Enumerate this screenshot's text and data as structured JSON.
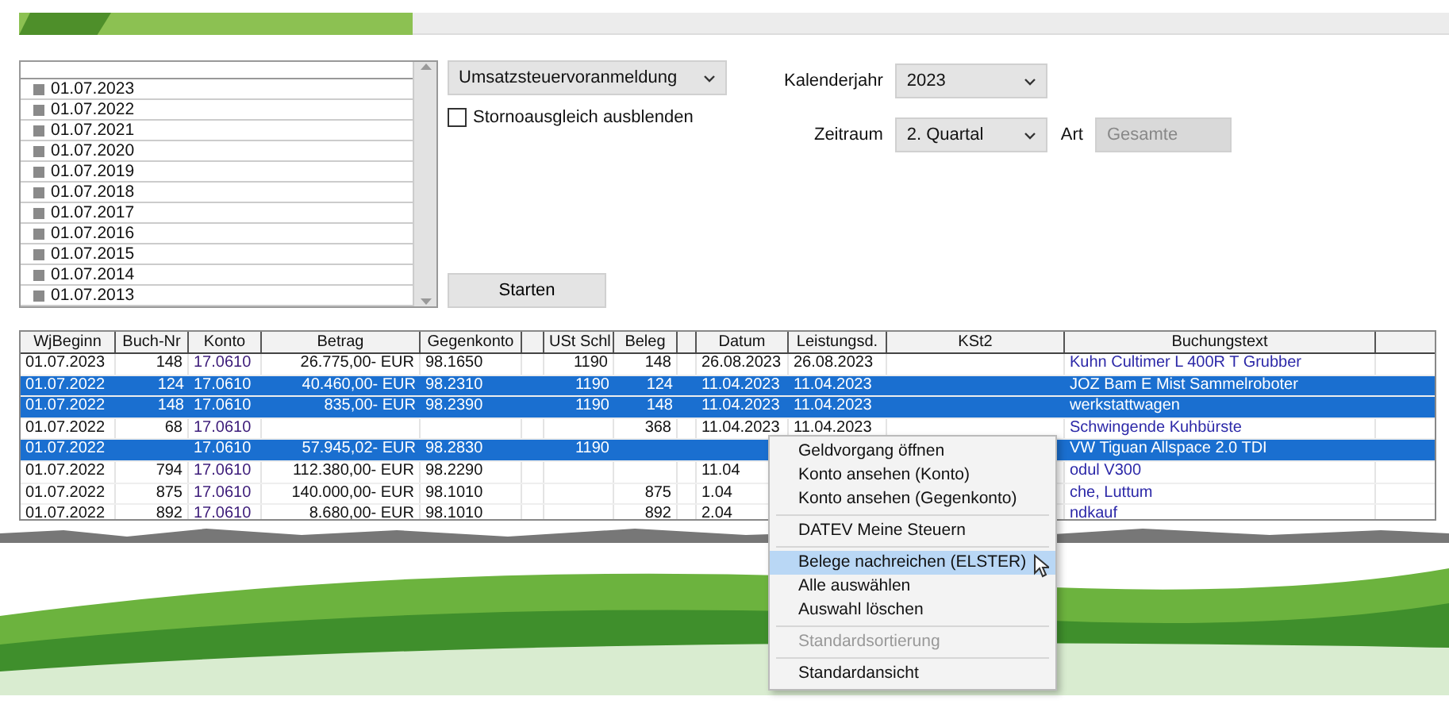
{
  "year_list": {
    "items": [
      {
        "label": "01.07.2023"
      },
      {
        "label": "01.07.2022"
      },
      {
        "label": "01.07.2021"
      },
      {
        "label": "01.07.2020"
      },
      {
        "label": "01.07.2019"
      },
      {
        "label": "01.07.2018"
      },
      {
        "label": "01.07.2017"
      },
      {
        "label": "01.07.2016"
      },
      {
        "label": "01.07.2015"
      },
      {
        "label": "01.07.2014"
      },
      {
        "label": "01.07.2013"
      }
    ]
  },
  "report_select": {
    "value": "Umsatzsteuervoranmeldung"
  },
  "storno_checkbox": {
    "label": "Stornoausgleich ausblenden",
    "checked": false
  },
  "calendar_year": {
    "label": "Kalenderjahr",
    "value": "2023",
    "disabled": false
  },
  "period": {
    "label": "Zeitraum",
    "value": "2. Quartal",
    "disabled": false
  },
  "art": {
    "label": "Art",
    "value": "Gesamte",
    "disabled": true
  },
  "start_button": "Starten",
  "table": {
    "columns": [
      "WjBeginn",
      "Buch-Nr",
      "Konto",
      "Betrag",
      "Gegenkonto",
      "USt Schl",
      "Beleg",
      "Datum",
      "Leistungsd.",
      "KSt2",
      "Buchungstext"
    ],
    "rows": [
      {
        "selected": false,
        "wj_beginn": "01.07.2023",
        "buch_nr": "148",
        "konto": "17.0610",
        "betrag": "26.775,00- EUR",
        "gegenkonto": "98.1650",
        "ust_schl": "1190",
        "beleg": "148",
        "datum": "26.08.2023",
        "leistungsdatum": "26.08.2023",
        "buchungstext": "Kuhn Cultimer L 400R T Grubber"
      },
      {
        "selected": true,
        "wj_beginn": "01.07.2022",
        "buch_nr": "124",
        "konto": "17.0610",
        "betrag": "40.460,00- EUR",
        "gegenkonto": "98.2310",
        "ust_schl": "1190",
        "beleg": "124",
        "datum": "11.04.2023",
        "leistungsdatum": "11.04.2023",
        "buchungstext": "JOZ Bam E Mist Sammelroboter"
      },
      {
        "selected": true,
        "wj_beginn": "01.07.2022",
        "buch_nr": "148",
        "konto": "17.0610",
        "betrag": "835,00- EUR",
        "gegenkonto": "98.2390",
        "ust_schl": "1190",
        "beleg": "148",
        "datum": "11.04.2023",
        "leistungsdatum": "11.04.2023",
        "buchungstext": "werkstattwagen"
      },
      {
        "selected": false,
        "wj_beginn": "01.07.2022",
        "buch_nr": "68",
        "konto": "17.0610",
        "beleg": "368",
        "datum": "11.04.2023",
        "leistungsdatum": "11.04.2023",
        "buchungstext": "Schwingende Kuhbürste"
      },
      {
        "selected": true,
        "wj_beginn": "01.07.2022",
        "konto": "17.0610",
        "betrag": "57.945,02- EUR",
        "gegenkonto": "98.2830",
        "ust_schl": "1190",
        "buchungstext": "VW Tiguan Allspace 2.0 TDI"
      },
      {
        "selected": false,
        "wj_beginn": "01.07.2022",
        "buch_nr": "794",
        "konto": "17.0610",
        "betrag": "112.380,00- EUR",
        "gegenkonto": "98.2290",
        "datum": "11.04",
        "buchungstext": "odul V300"
      },
      {
        "selected": false,
        "wj_beginn": "01.07.2022",
        "buch_nr": "875",
        "konto": "17.0610",
        "betrag": "140.000,00- EUR",
        "gegenkonto": "98.1010",
        "beleg": "875",
        "datum": "1.04",
        "buchungstext": "che, Luttum"
      },
      {
        "selected": false,
        "wj_beginn": "01.07.2022",
        "buch_nr": "892",
        "konto": "17.0610",
        "betrag": "8.680,00- EUR",
        "gegenkonto": "98.1010",
        "beleg": "892",
        "datum": "2.04",
        "buchungstext": "ndkauf"
      }
    ]
  },
  "context_menu": {
    "items": [
      {
        "label": "Geldvorgang öffnen",
        "disabled": false,
        "selected": false,
        "separator_after": false
      },
      {
        "label": "Konto ansehen (Konto)",
        "disabled": false,
        "selected": false,
        "separator_after": false
      },
      {
        "label": "Konto ansehen (Gegenkonto)",
        "disabled": false,
        "selected": false,
        "separator_after": true
      },
      {
        "label": "DATEV Meine Steuern",
        "disabled": false,
        "selected": false,
        "separator_after": true
      },
      {
        "label": "Belege nachreichen (ELSTER)",
        "disabled": false,
        "selected": true,
        "separator_after": false
      },
      {
        "label": "Alle auswählen",
        "disabled": false,
        "selected": false,
        "separator_after": false
      },
      {
        "label": "Auswahl löschen",
        "disabled": false,
        "selected": false,
        "separator_after": true
      },
      {
        "label": "Standardsortierung",
        "disabled": true,
        "selected": false,
        "separator_after": true
      },
      {
        "label": "Standardansicht",
        "disabled": false,
        "selected": false,
        "separator_after": false
      }
    ]
  }
}
